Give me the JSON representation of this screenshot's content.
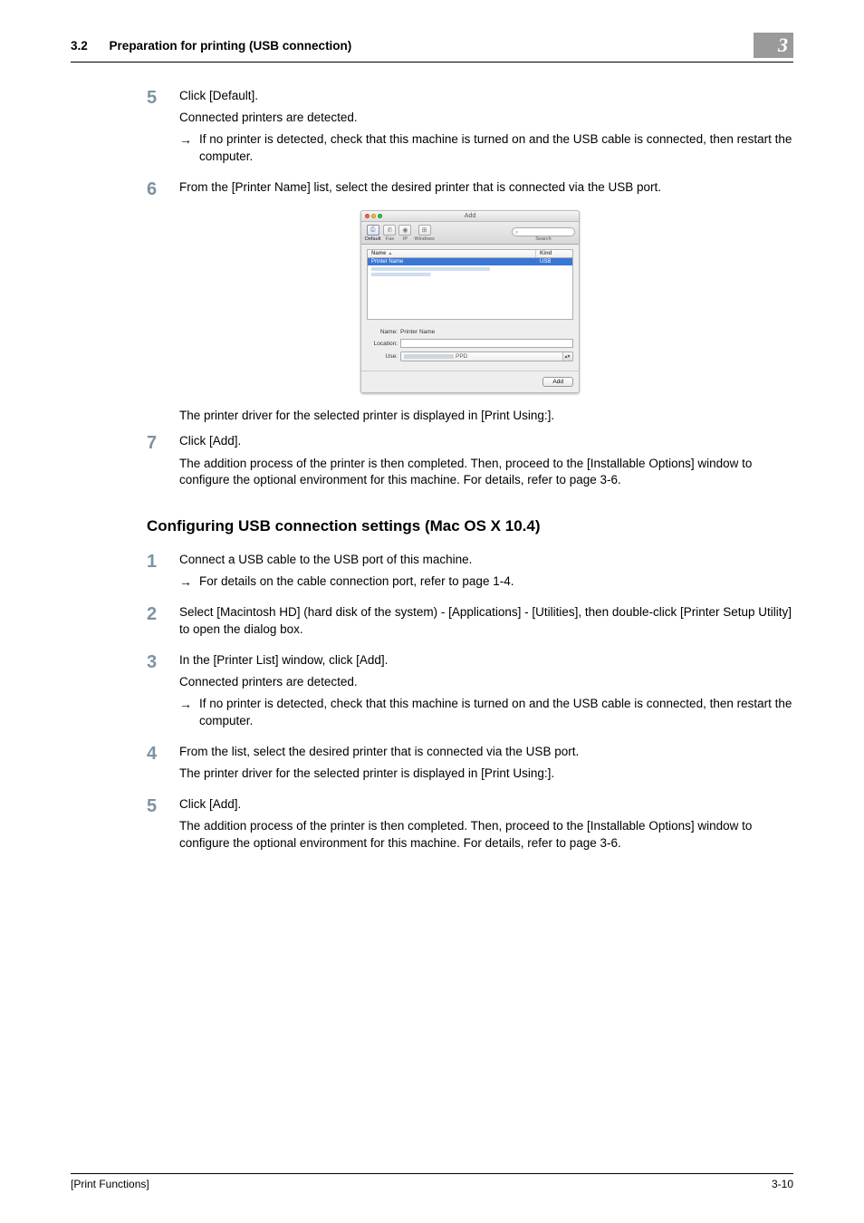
{
  "header": {
    "section_num": "3.2",
    "section_title": "Preparation for printing (USB connection)",
    "chapter_badge": "3"
  },
  "steps_a": [
    {
      "num": "5",
      "lines": [
        "Click [Default]."
      ],
      "after": [
        "Connected printers are detected."
      ],
      "notes": [
        "If no printer is detected, check that this machine is turned on and the USB cable is connected, then restart the computer."
      ]
    },
    {
      "num": "6",
      "lines": [
        "From the [Printer Name] list, select the desired printer that is connected via the USB port."
      ]
    }
  ],
  "dialog": {
    "title": "Add",
    "tabs": {
      "default": "Default",
      "fax": "Fax",
      "ip": "IP",
      "windows": "Windows"
    },
    "search": {
      "placeholder": "",
      "label": "Search",
      "glyph": "⌕"
    },
    "list": {
      "col_name": "Name",
      "col_kind": "Kind",
      "row_name": "Printer Name",
      "row_kind": "USB"
    },
    "form": {
      "name_label": "Name:",
      "name_value": "Printer Name",
      "location_label": "Location:",
      "use_label": "Use:",
      "use_suffix": "PPD",
      "caret": "▴▾"
    },
    "add_btn": "Add"
  },
  "after_dialog": "The printer driver for the selected printer is displayed in [Print Using:].",
  "step7": {
    "num": "7",
    "lines": [
      "Click [Add]."
    ],
    "after": [
      "The addition process of the printer is then completed. Then, proceed to the [Installable Options] window to configure the optional environment for this machine. For details, refer to page 3-6."
    ]
  },
  "subsection": "Configuring USB connection settings (Mac OS X 10.4)",
  "steps_b": [
    {
      "num": "1",
      "lines": [
        "Connect a USB cable to the USB port of this machine."
      ],
      "notes": [
        "For details on the cable connection port, refer to page 1-4."
      ]
    },
    {
      "num": "2",
      "lines": [
        "Select [Macintosh HD] (hard disk of the system) - [Applications] - [Utilities], then double-click [Printer Setup Utility] to open the dialog box."
      ]
    },
    {
      "num": "3",
      "lines": [
        "In the [Printer List] window, click [Add]."
      ],
      "after": [
        "Connected printers are detected."
      ],
      "notes": [
        "If no printer is detected, check that this machine is turned on and the USB cable is connected, then restart the computer."
      ]
    },
    {
      "num": "4",
      "lines": [
        "From the list, select the desired printer that is connected via the USB port."
      ],
      "after": [
        "The printer driver for the selected printer is displayed in [Print Using:]."
      ]
    },
    {
      "num": "5",
      "lines": [
        "Click [Add]."
      ],
      "after": [
        "The addition process of the printer is then completed. Then, proceed to the [Installable Options] window to configure the optional environment for this machine. For details, refer to page 3-6."
      ]
    }
  ],
  "footer": {
    "left": "[Print Functions]",
    "right": "3-10"
  },
  "arrow": "→"
}
